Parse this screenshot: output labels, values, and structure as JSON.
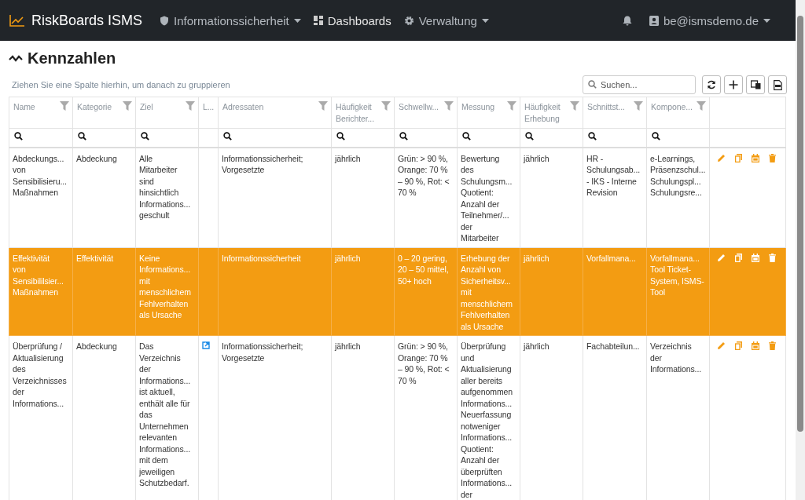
{
  "navbar": {
    "brand": "RiskBoards ISMS",
    "menus": [
      {
        "label": "Informationssicherheit",
        "kind": "dropdown"
      },
      {
        "label": "Dashboards",
        "kind": "link"
      },
      {
        "label": "Verwaltung",
        "kind": "dropdown"
      }
    ],
    "user": "be@ismsdemo.de"
  },
  "page": {
    "title": "Kennzahlen",
    "group_hint": "Ziehen Sie eine Spalte hierhin, um danach zu gruppieren",
    "search": {
      "placeholder": "Suchen..."
    }
  },
  "table": {
    "columns": [
      {
        "label": "Name",
        "filter": true
      },
      {
        "label": "Kategorie",
        "filter": true
      },
      {
        "label": "Ziel",
        "filter": true
      },
      {
        "label": "L...",
        "filter": false
      },
      {
        "label": "Adressaten",
        "filter": true
      },
      {
        "label": "Häufigkeit\nBerichter...",
        "filter": true
      },
      {
        "label": "Schwellw...",
        "filter": true
      },
      {
        "label": "Messung",
        "filter": true
      },
      {
        "label": "Häufigkeit\nErhebung",
        "filter": true
      },
      {
        "label": "Schnittst...",
        "filter": true
      },
      {
        "label": "Kompone...",
        "filter": true
      }
    ],
    "rows": [
      {
        "selected": false,
        "link": false,
        "cells": [
          "Abdeckungs...\nvon\nSensibilisieru...\nMaßnahmen",
          "Abdeckung",
          "Alle\nMitarbeiter\nsind\nhinsichtlich\nInformations...\ngeschult",
          "",
          "Informationssicherheit;\nVorgesetzte",
          "jährlich",
          "Grün: > 90 %,\nOrange: 70 %\n– 90 %, Rot: <\n70 %",
          "Bewertung\ndes\nSchulungsm...\nQuotient:\nAnzahl der\nTeilnehmer/...\nder\nMitarbeiter",
          "jährlich",
          "HR -\nSchulungsab...\n- IKS - Interne\nRevision",
          "e-Learnings,\nPräsenzschul...\nSchulungspl...\nSchulungsre..."
        ]
      },
      {
        "selected": true,
        "link": false,
        "cells": [
          "Effektivität\nvon\nSensibililsier...\nMaßnahmen",
          "Effektivität",
          "Keine\nInformations...\nmit\nmenschlichem\nFehlverhalten\nals Ursache",
          "",
          "Informationssicherheit",
          "jährlich",
          "0 – 20 gering,\n20 – 50 mittel,\n50+ hoch",
          "Erhebung der\nAnzahl von\nSicherheitsv...\nmit\nmenschlichem\nFehlverhalten\nals Ursache",
          "jährlich",
          "Vorfallmana...",
          "Vorfallmana...\nTool Ticket-\nSystem, ISMS-\nTool"
        ]
      },
      {
        "selected": false,
        "link": true,
        "cells": [
          "Überprüfung /\nAktualisierung\ndes\nVerzeichnisses\nder\nInformations...",
          "Abdeckung",
          "Das\nVerzeichnis\nder\nInformations...\nist aktuell,\nenthält alle für\ndas\nUnternehmen\nrelevanten\nInformations...\nmit dem\njeweiligen\nSchutzbedarf.",
          "",
          "Informationssicherheit;\nVorgesetzte",
          "jährlich",
          "Grün: > 90 %,\nOrange: 70 %\n– 90 %, Rot: <\n70 %",
          "Überprüfung\nund\nAktualisierung\naller bereits\naufgenommen\nInformations...\nNeuerfassung\nnotweniger\nInformations...\nQuotient:\nAnzahl der\nüberprüften\nInformations...\nder",
          "jährlich",
          "Fachabteilun...",
          "Verzeichnis\nder\nInformations..."
        ]
      }
    ]
  }
}
